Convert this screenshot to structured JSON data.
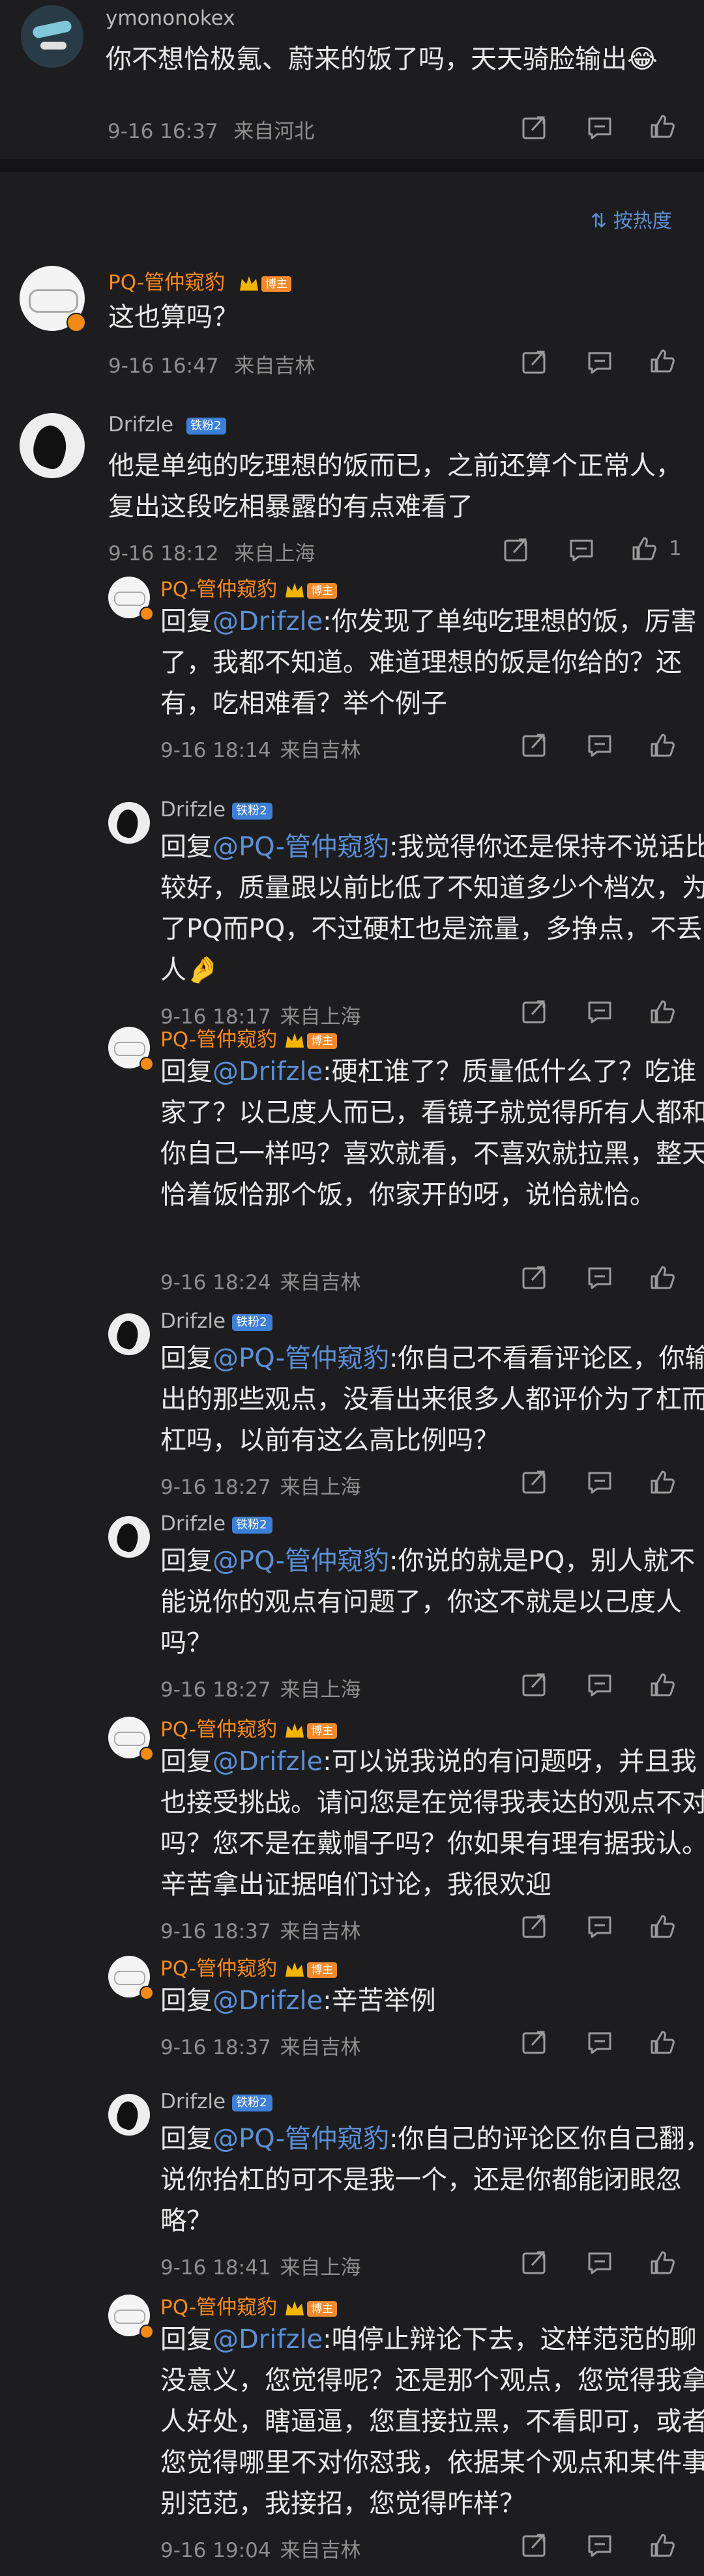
{
  "top_comment": {
    "user": "ymononokex",
    "text": "你不想恰极氪、蔚来的饭了吗，天天骑脸输出😂",
    "time": "9-16 16:37",
    "location": "来自河北"
  },
  "sort": {
    "label": "按热度",
    "icon": "sort-icon"
  },
  "threads": [
    {
      "user": "PQ-管仲窥豹",
      "owner_tag": "博主",
      "text": "这也算吗？",
      "time": "9-16 16:47",
      "location": "来自吉林"
    },
    {
      "user": "Drifzle",
      "fans_badge": "铁粉2",
      "text": "他是单纯的吃理想的饭而已，之前还算个正常人，复出这段吃相暴露的有点难看了",
      "time": "9-16 18:12",
      "location": "来自上海",
      "like_count": "1"
    }
  ],
  "replies": [
    {
      "user": "PQ-管仲窥豹",
      "badge": "博主",
      "mention": "@Drifzle",
      "text": "回复@Drifzle:你发现了单纯吃理想的饭，厉害了，我都不知道。难道理想的饭是你给的？还有，吃相难看？举个例子",
      "time": "9-16 18:14",
      "location": "来自吉林"
    },
    {
      "user": "Drifzle",
      "badge": "铁粉2",
      "mention": "@PQ-管仲窥豹",
      "text": "回复@PQ-管仲窥豹:我觉得你还是保持不说话比较好，质量跟以前比低了不知道多少个档次，为了PQ而PQ，不过硬杠也是流量，多挣点，不丢人🤌",
      "time": "9-16 18:17",
      "location": "来自上海"
    },
    {
      "user": "PQ-管仲窥豹",
      "badge": "博主",
      "mention": "@Drifzle",
      "text": "回复@Drifzle:硬杠谁了？质量低什么了？吃谁家了？以己度人而已，看镜子就觉得所有人都和你自己一样吗？喜欢就看，不喜欢就拉黑，整天恰着饭恰那个饭，你家开的呀，说恰就恰。",
      "time": "9-16 18:24",
      "location": "来自吉林"
    },
    {
      "user": "Drifzle",
      "badge": "铁粉2",
      "mention": "@PQ-管仲窥豹",
      "text": "回复@PQ-管仲窥豹:你自己不看看评论区，你输出的那些观点，没看出来很多人都评价为了杠而杠吗，以前有这么高比例吗？",
      "time": "9-16 18:27",
      "location": "来自上海"
    },
    {
      "user": "Drifzle",
      "badge": "铁粉2",
      "mention": "@PQ-管仲窥豹",
      "text": "回复@PQ-管仲窥豹:你说的就是PQ，别人就不能说你的观点有问题了，你这不就是以己度人吗？",
      "time": "9-16 18:27",
      "location": "来自上海"
    },
    {
      "user": "PQ-管仲窥豹",
      "badge": "博主",
      "mention": "@Drifzle",
      "text": "回复@Drifzle:可以说我说的有问题呀，并且我也接受挑战。请问您是在觉得我表达的观点不对吗？您不是在戴帽子吗？你如果有理有据我认。辛苦拿出证据咱们讨论，我很欢迎",
      "time": "9-16 18:37",
      "location": "来自吉林"
    },
    {
      "user": "PQ-管仲窥豹",
      "badge": "博主",
      "mention": "@Drifzle",
      "text": "回复@Drifzle:辛苦举例",
      "time": "9-16 18:37",
      "location": "来自吉林"
    },
    {
      "user": "Drifzle",
      "badge": "铁粉2",
      "mention": "@PQ-管仲窥豹",
      "text": "回复@PQ-管仲窥豹:你自己的评论区你自己翻，说你抬杠的可不是我一个，还是你都能闭眼忽略？",
      "time": "9-16 18:41",
      "location": "来自上海"
    },
    {
      "user": "PQ-管仲窥豹",
      "badge": "博主",
      "mention": "@Drifzle",
      "text": "回复@Drifzle:咱停止辩论下去，这样范范的聊没意义，您觉得呢？还是那个观点，您觉得我拿人好处，瞎逼逼，您直接拉黑，不看即可，或者您觉得哪里不对你怼我，依据某个观点和某件事别范范，我接招，您觉得咋样？",
      "time": "9-16 19:04",
      "location": "来自吉林"
    }
  ],
  "action_icons": [
    "share-icon",
    "comment-icon",
    "like-icon"
  ],
  "colors": {
    "background": "#1d1d1f",
    "mention": "#5b8fd6",
    "owner_name": "#ff8a1a",
    "meta": "#8e8e8e"
  }
}
